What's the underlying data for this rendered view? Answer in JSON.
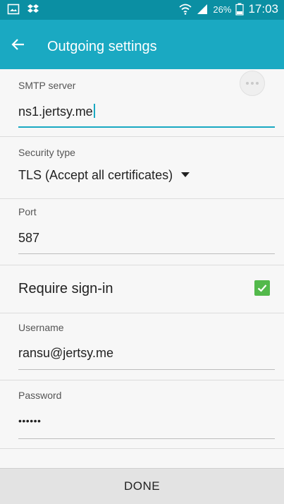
{
  "status_bar": {
    "battery_percent": "26%",
    "time": "17:03",
    "icons": [
      "gallery-icon",
      "dropbox-icon",
      "wifi-icon",
      "signal-icon",
      "battery-icon"
    ]
  },
  "app_bar": {
    "title": "Outgoing settings",
    "back_icon": "arrow-left-icon"
  },
  "form": {
    "smtp_server": {
      "label": "SMTP server",
      "value": "ns1.jertsy.me"
    },
    "security_type": {
      "label": "Security type",
      "value": "TLS (Accept all certificates)"
    },
    "port": {
      "label": "Port",
      "value": "587"
    },
    "require_signin": {
      "label": "Require sign-in",
      "checked": true
    },
    "username": {
      "label": "Username",
      "value": "ransu@jertsy.me"
    },
    "password": {
      "label": "Password",
      "value": "••••••"
    }
  },
  "footer": {
    "done_label": "DONE"
  },
  "colors": {
    "status_bar": "#0b8fa3",
    "app_bar": "#1aa9c2",
    "checkbox": "#53b94b",
    "background": "#f7f7f7"
  }
}
